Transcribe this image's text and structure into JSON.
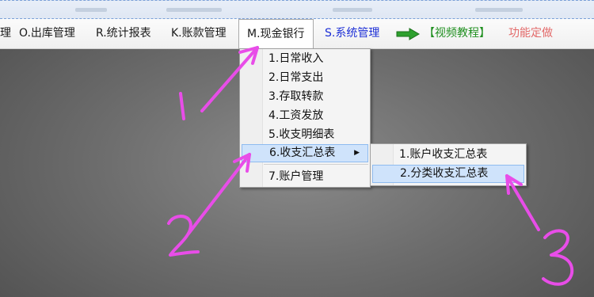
{
  "menubar": {
    "items": [
      {
        "label": "理"
      },
      {
        "label": "O.出库管理"
      },
      {
        "label": "R.统计报表"
      },
      {
        "label": "K.账款管理"
      },
      {
        "label": "M.现金银行"
      },
      {
        "label": "S.系统管理"
      },
      {
        "label": "【视频教程】"
      },
      {
        "label": "功能定做"
      }
    ]
  },
  "dropdown": {
    "items": [
      {
        "label": "1.日常收入"
      },
      {
        "label": "2.日常支出"
      },
      {
        "label": "3.存取转款"
      },
      {
        "label": "4.工资发放"
      },
      {
        "label": "5.收支明细表"
      },
      {
        "label": "6.收支汇总表"
      },
      {
        "label": "7.账户管理"
      }
    ]
  },
  "submenu": {
    "items": [
      {
        "label": "1.账户收支汇总表"
      },
      {
        "label": "2.分类收支汇总表"
      }
    ]
  },
  "annotations": {
    "marks": [
      "1",
      "2",
      "3"
    ],
    "color": "#e84de8"
  },
  "colors": {
    "highlight": "#cfe3fb",
    "system_menu": "#1d2fd6",
    "video_link": "#1f8f1f",
    "custom_link": "#e36a6a"
  }
}
